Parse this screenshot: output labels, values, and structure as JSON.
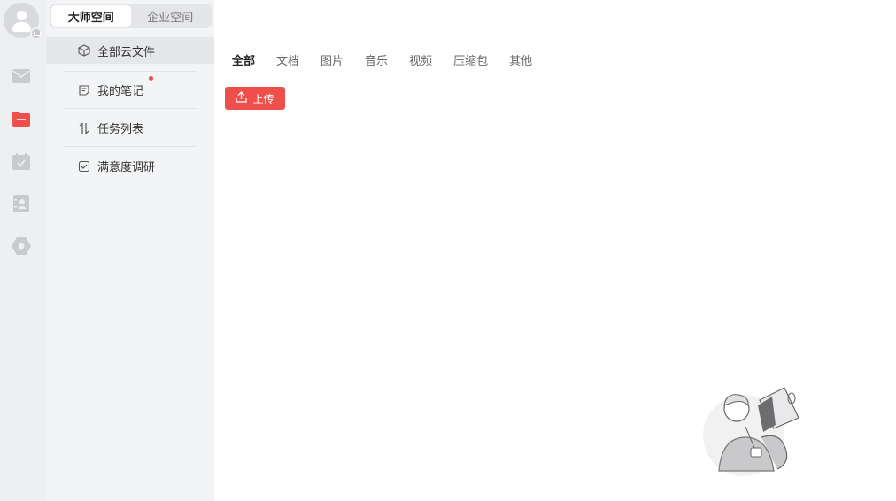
{
  "segments": [
    "大师空间",
    "企业空间"
  ],
  "nav": {
    "items": [
      {
        "label": "全部云文件",
        "icon": "cube-icon"
      },
      {
        "label": "我的笔记",
        "icon": "note-icon"
      },
      {
        "label": "任务列表",
        "icon": "sort-arrows-icon"
      },
      {
        "label": "满意度调研",
        "icon": "checkbox-icon"
      }
    ]
  },
  "tabs": [
    "全部",
    "文档",
    "图片",
    "音乐",
    "视频",
    "压缩包",
    "其他"
  ],
  "upload_label": "上传",
  "colors": {
    "accent": "#ef4f4a",
    "rail_bg": "#eeeff1",
    "nav_bg": "#f3f4f6"
  }
}
